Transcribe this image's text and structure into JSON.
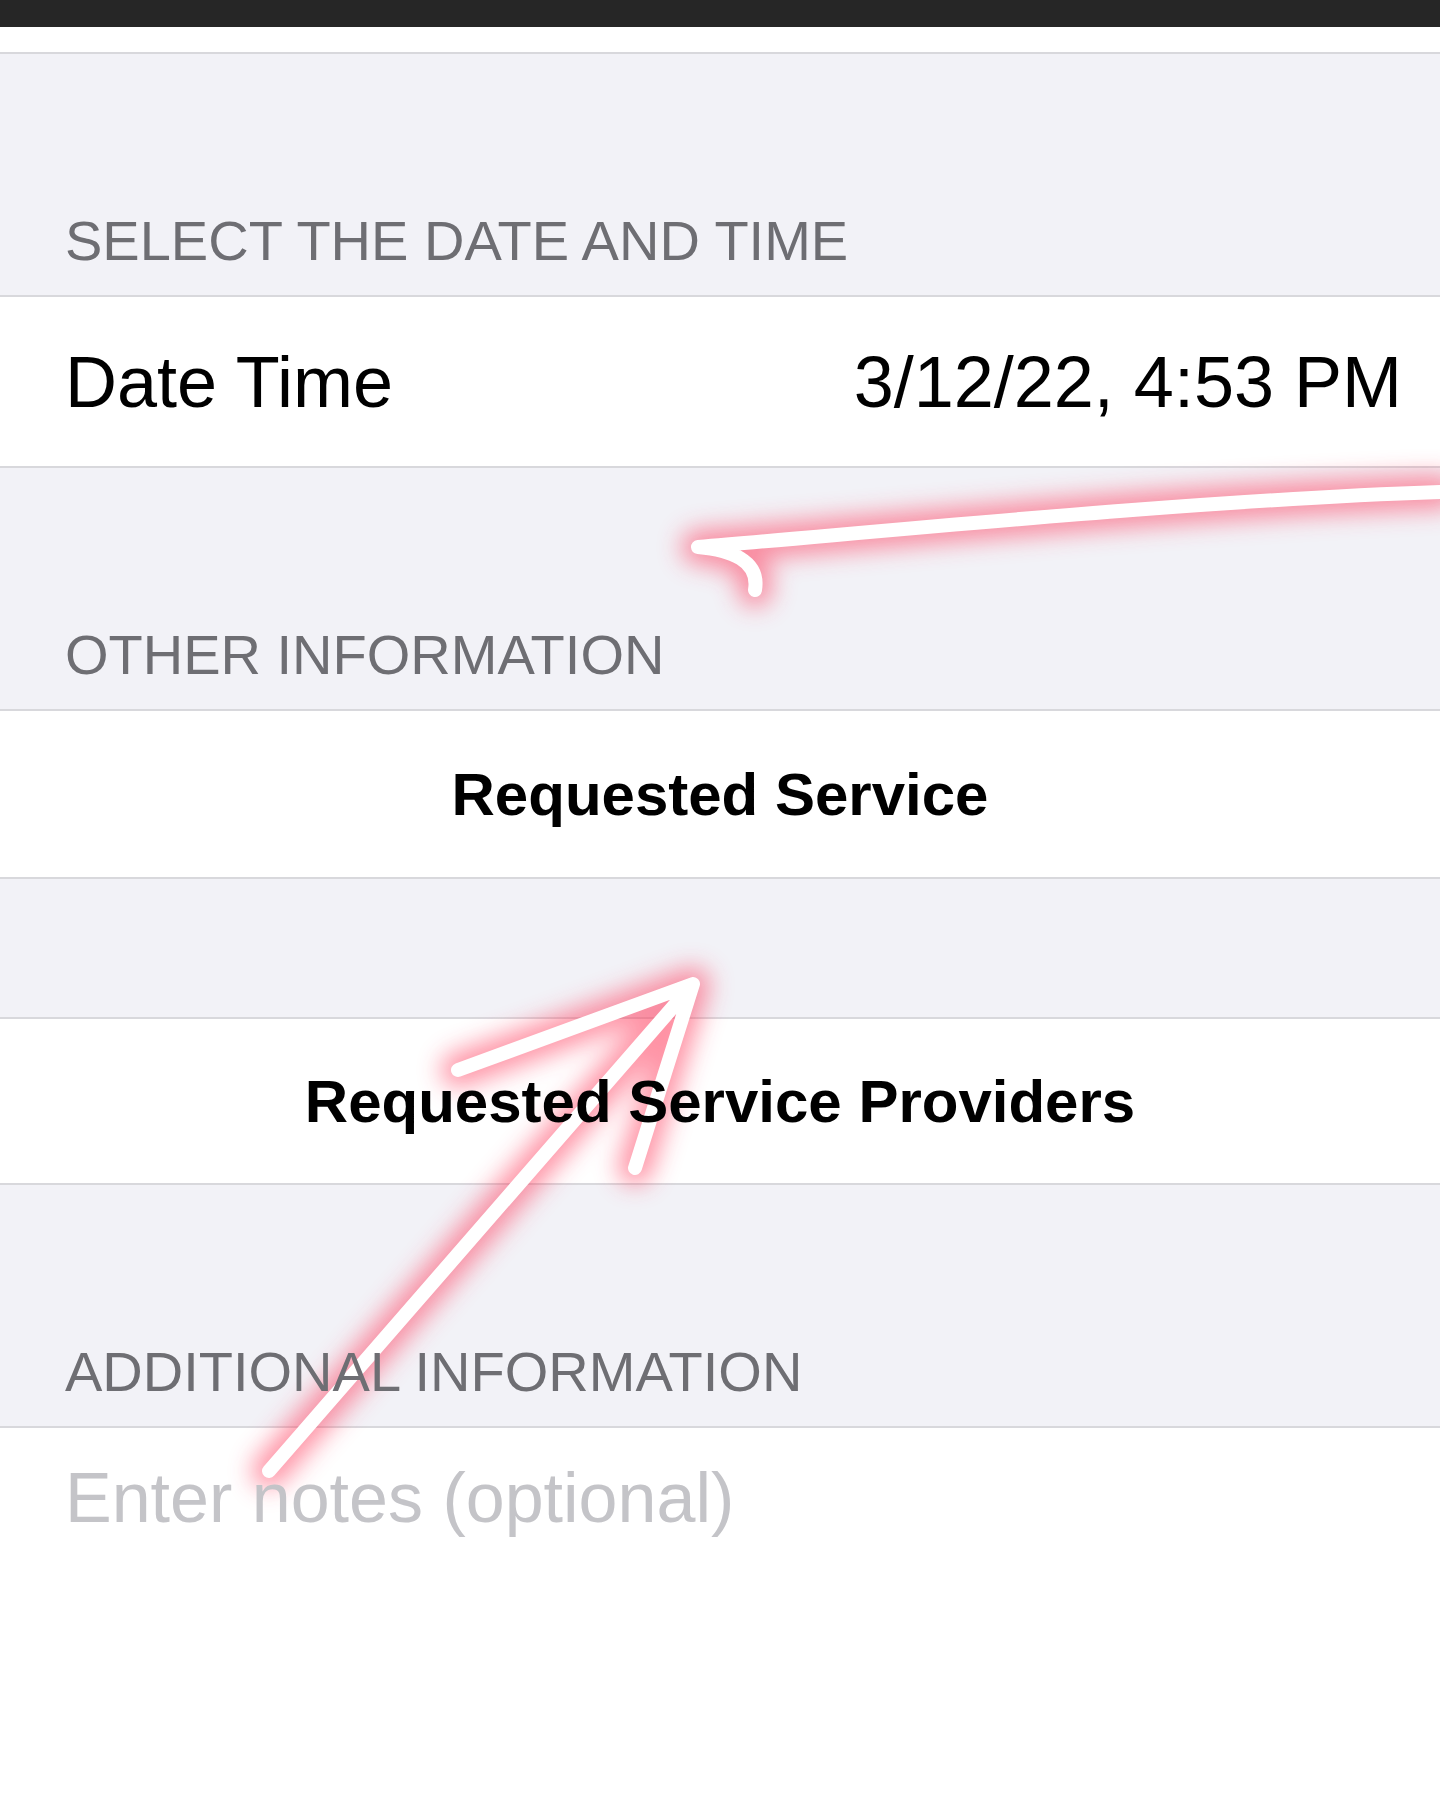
{
  "form": [
    {
      "kind": "header",
      "label": "SELECT THE DATE AND TIME"
    },
    {
      "kind": "value_row",
      "label": "Date Time",
      "value": "3/12/22, 4:53 PM"
    },
    {
      "kind": "header",
      "label": "OTHER INFORMATION"
    },
    {
      "kind": "button_row",
      "label": "Requested Service"
    },
    {
      "kind": "button_row",
      "label": "Requested Service Providers"
    },
    {
      "kind": "header",
      "label": "ADDITIONAL INFORMATION"
    },
    {
      "kind": "notes",
      "placeholder": "Enter notes (optional)"
    }
  ],
  "annotations": [
    {
      "kind": "arrow"
    },
    {
      "kind": "arrow"
    }
  ]
}
